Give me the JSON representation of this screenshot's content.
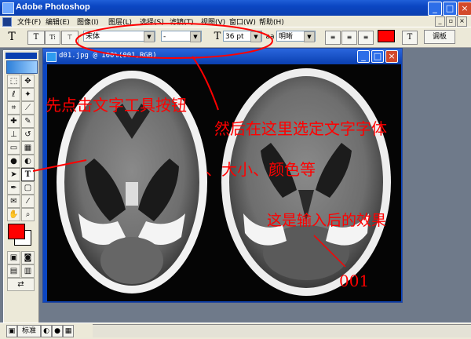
{
  "app": {
    "title": "Adobe Photoshop"
  },
  "menu": [
    "编辑(E)",
    "图像(I)",
    "图层(L)",
    "选择(S)",
    "滤镜(T)",
    "视图(V)",
    "窗口(W)",
    "帮助(H)"
  ],
  "options": {
    "tool_glyph": "T",
    "font_family": "宋体",
    "font_style": "-",
    "size_glyph": "T",
    "font_size": "36 pt",
    "aa_label": "aa",
    "antialias": "明晰",
    "text_color": "#ff0000",
    "palettes_button": "调板"
  },
  "document": {
    "title": "d01.jpg @ 100%(001,RGB)"
  },
  "status": {
    "standard_label": "标准"
  },
  "annotations": {
    "click_text_tool": "先点击文字工具按钮",
    "select_font": "然后在这里选定文字字体",
    "size_color": "、大小、颜色等",
    "after_input": "这是输入后的效果",
    "sample_text": "001"
  },
  "colors": {
    "accent": "#ff0000",
    "titlebar": "#0a3fb0",
    "chrome": "#ece9d8"
  }
}
